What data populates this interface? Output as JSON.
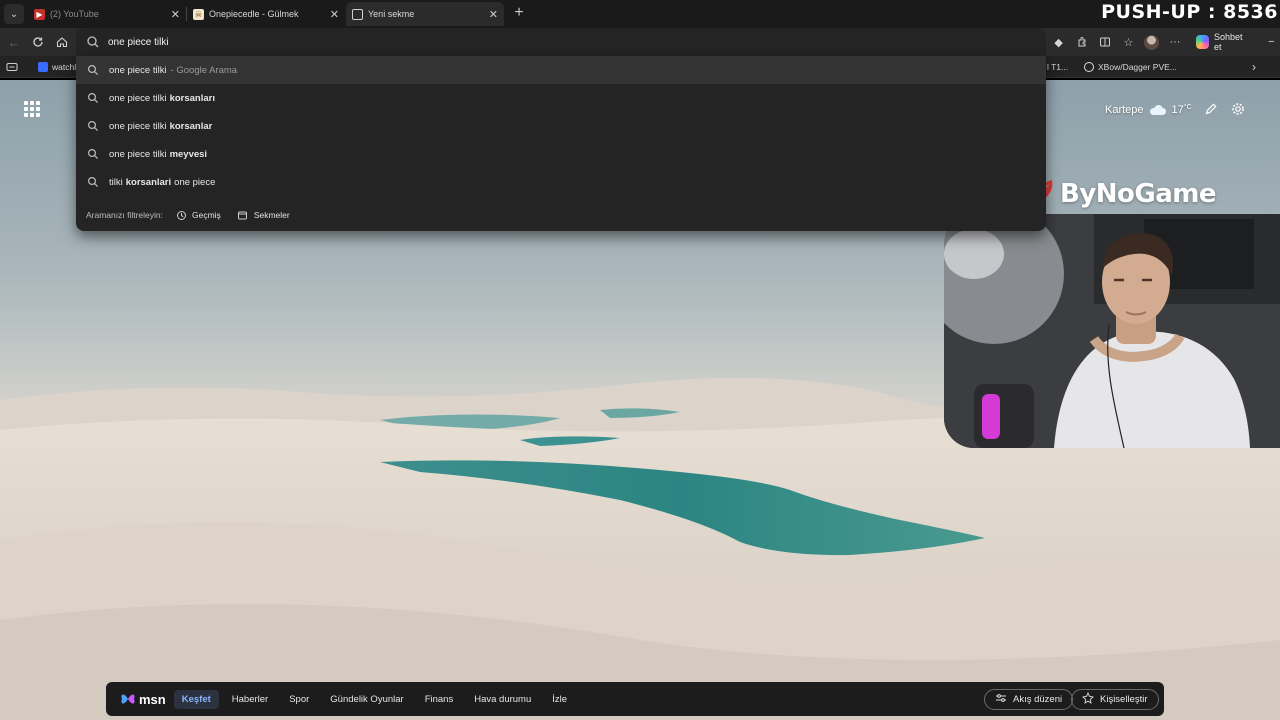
{
  "overlay": {
    "pushup": "PUSH-UP : 8536"
  },
  "tabs": [
    {
      "title": "(2) YouTube",
      "favicon": "youtube-icon",
      "state": "dim"
    },
    {
      "title": "Onepiecedle - Gülmek",
      "favicon": "onepiecedle-icon",
      "state": "normal"
    },
    {
      "title": "Yeni sekme",
      "favicon": "new-tab-page-icon",
      "state": "active"
    }
  ],
  "omnibox": {
    "value": "one piece tilki"
  },
  "bookmarks": {
    "left_label": "watchl",
    "mid_label": "l T1...",
    "right_label": "XBow/Dagger PVE..."
  },
  "toolbar": {
    "copilot_label": "Sohbet et"
  },
  "suggestions": [
    {
      "prefix": "one piece tilki",
      "bold": "",
      "suffix": "",
      "muted": "- Google Arama"
    },
    {
      "prefix": "one piece tilki",
      "bold": "korsanları",
      "suffix": "",
      "muted": ""
    },
    {
      "prefix": "one piece tilki",
      "bold": "korsanlar",
      "suffix": "",
      "muted": ""
    },
    {
      "prefix": "one piece tilki",
      "bold": "meyvesi",
      "suffix": "",
      "muted": ""
    },
    {
      "prefix": "tilki",
      "bold": "korsanlari",
      "suffix": "one piece",
      "muted": ""
    }
  ],
  "filter": {
    "label": "Aramanızı filtreleyin:",
    "history": "Geçmiş",
    "tabs": "Sekmeler"
  },
  "weather": {
    "location": "Kartepe",
    "temp": "17",
    "unit": "°C"
  },
  "sponsor": {
    "brand": "ByNoGame"
  },
  "msn": {
    "logo": "msn",
    "nav": [
      "Keşfet",
      "Haberler",
      "Spor",
      "Gündelik Oyunlar",
      "Finans",
      "Hava durumu",
      "İzle"
    ],
    "layout_button": "Akış düzeni",
    "personalize_button": "Kişiselleştir"
  },
  "colors": {
    "accent": "#8ab4ff",
    "lagoon": "#2f8f8a",
    "bar": "#1c1c1c"
  }
}
